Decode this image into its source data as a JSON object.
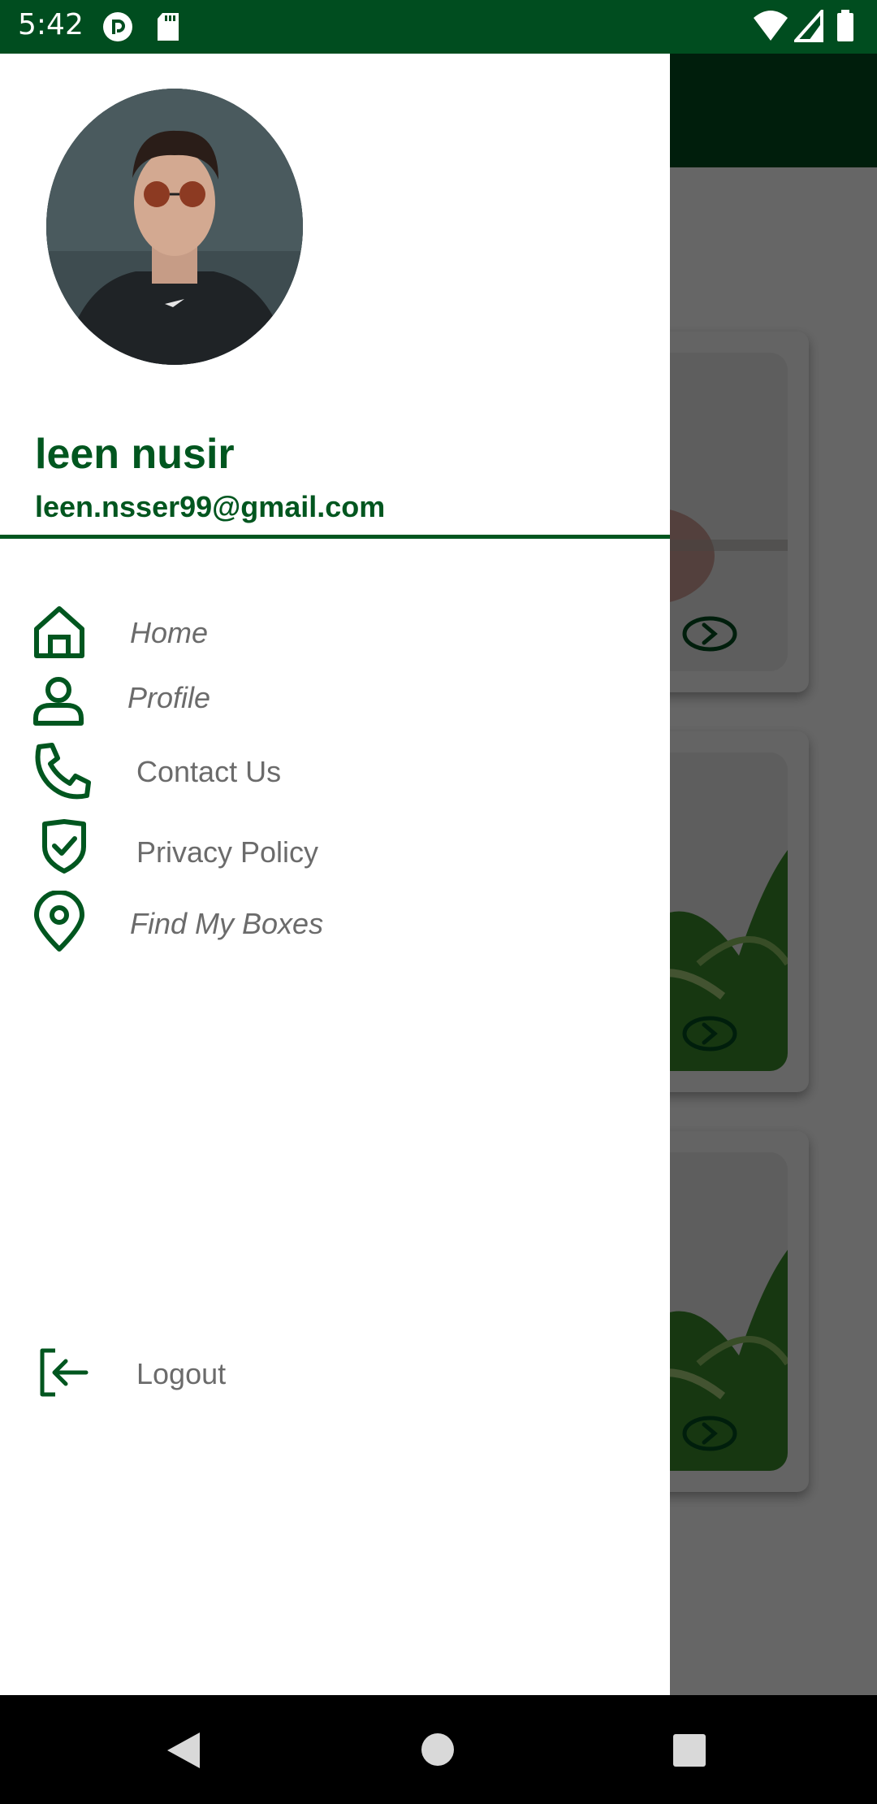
{
  "status_bar": {
    "time": "5:42",
    "icons_left": [
      "pocket-casts-icon",
      "sd-card-icon"
    ],
    "icons_right": [
      "wifi-icon",
      "signal-icon",
      "battery-icon"
    ]
  },
  "drawer": {
    "user_name": "leen nusir",
    "user_email": "leen.nsser99@gmail.com",
    "items": [
      {
        "label": "Home",
        "icon": "home-icon"
      },
      {
        "label": "Profile",
        "icon": "person-icon"
      },
      {
        "label": "Contact Us",
        "icon": "phone-icon"
      },
      {
        "label": "Privacy Policy",
        "icon": "shield-check-icon"
      },
      {
        "label": "Find My Boxes",
        "icon": "location-pin-icon"
      }
    ],
    "logout_label": "Logout"
  },
  "colors": {
    "primary": "#00561f",
    "status_bar": "#004d1f",
    "label_gray": "#6b6b6b",
    "scrim": "rgba(0,0,0,0.6)"
  },
  "nav_bar": {
    "buttons": [
      "back-button",
      "home-button",
      "recents-button"
    ]
  }
}
